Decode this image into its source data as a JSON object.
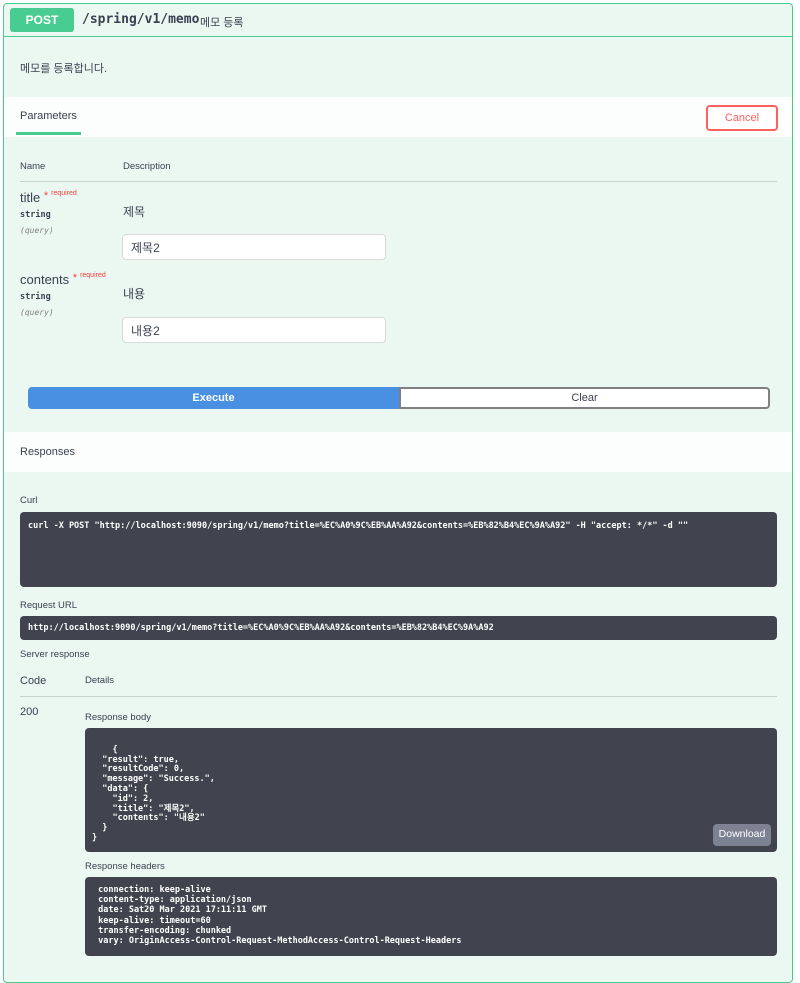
{
  "operation": {
    "method": "POST",
    "path": "/spring/v1/memo",
    "summary": "메모 등록",
    "description": "메모를 등록합니다."
  },
  "parameters_section": {
    "tab_label": "Parameters",
    "cancel_label": "Cancel",
    "col_name": "Name",
    "col_description": "Description",
    "required_label": "required",
    "items": [
      {
        "name": "title",
        "type": "string",
        "in": "(query)",
        "description": "제목",
        "value": "제목2"
      },
      {
        "name": "contents",
        "type": "string",
        "in": "(query)",
        "description": "내용",
        "value": "내용2"
      }
    ]
  },
  "actions": {
    "execute_label": "Execute",
    "clear_label": "Clear"
  },
  "responses_section": {
    "title": "Responses",
    "curl_label": "Curl",
    "curl": "curl -X POST \"http://localhost:9090/spring/v1/memo?title=%EC%A0%9C%EB%AA%A92&contents=%EB%82%B4%EC%9A%A92\" -H \"accept: */*\" -d \"\"",
    "request_url_label": "Request URL",
    "request_url": "http://localhost:9090/spring/v1/memo?title=%EC%A0%9C%EB%AA%A92&contents=%EB%82%B4%EC%9A%A92",
    "server_response_label": "Server response",
    "col_code": "Code",
    "col_details": "Details",
    "code": "200",
    "response_body_label": "Response body",
    "response_body": "{\n  \"result\": true,\n  \"resultCode\": 0,\n  \"message\": \"Success.\",\n  \"data\": {\n    \"id\": 2,\n    \"title\": \"제목2\",\n    \"contents\": \"내용2\"\n  }\n}",
    "download_label": "Download",
    "response_headers_label": "Response headers",
    "response_headers": " connection: keep-alive \n content-type: application/json \n date: Sat20 Mar 2021 17:11:11 GMT \n keep-alive: timeout=60 \n transfer-encoding: chunked \n vary: OriginAccess-Control-Request-MethodAccess-Control-Request-Headers "
  },
  "colors": {
    "post_green": "#49cc90",
    "block_bg": "#ebf7f1",
    "execute_blue": "#4990e2",
    "cancel_red": "#ff6060",
    "code_bg": "#41444e"
  }
}
